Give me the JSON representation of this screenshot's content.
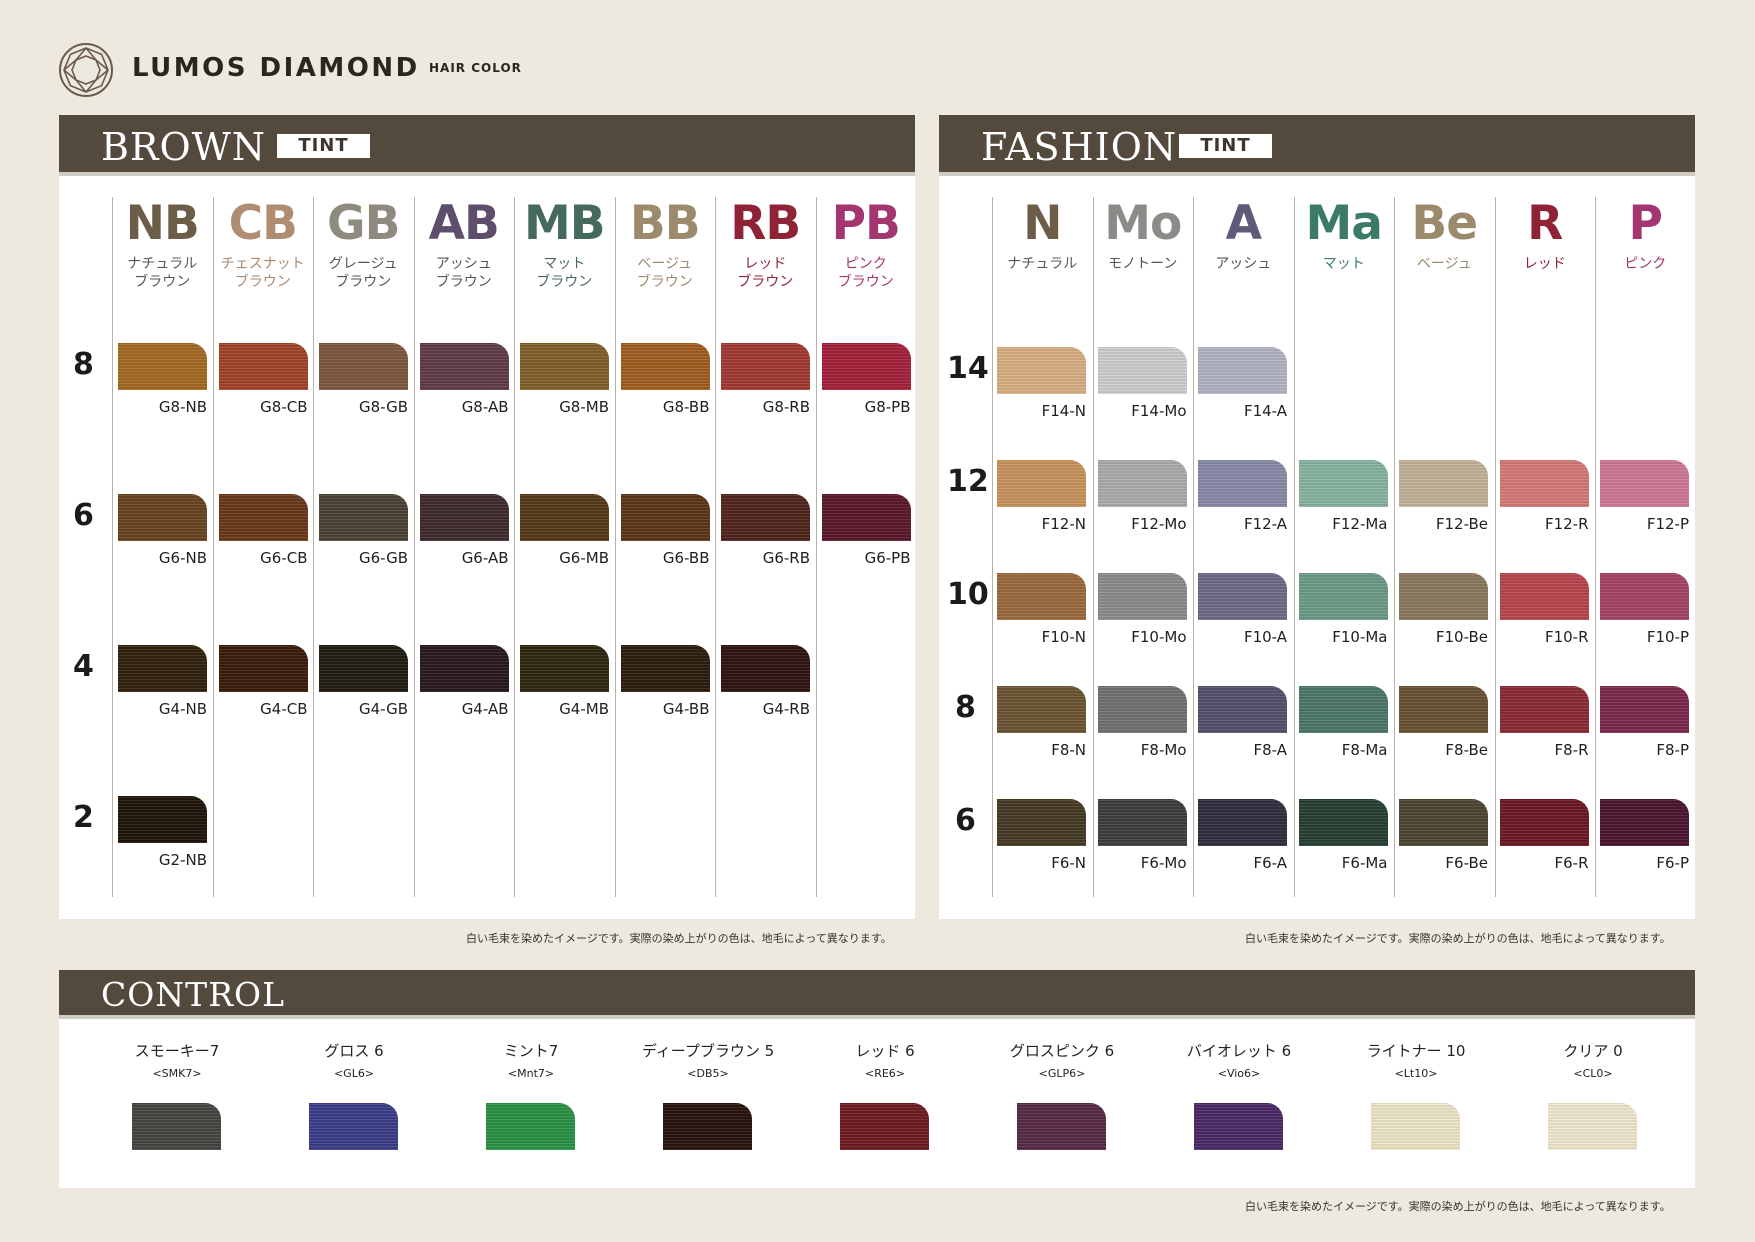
{
  "brand": {
    "name": "LUMOS DIAMOND",
    "sub": "HAIR COLOR"
  },
  "brown": {
    "title": "BROWN",
    "tag": "TINT",
    "note": "白い毛束を染めたイメージです。実際の染め上がりの色は、地毛によって異なります。",
    "levels": [
      "8",
      "6",
      "4",
      "2"
    ],
    "columns": [
      {
        "code": "NB",
        "name1": "ナチュラル",
        "name2": "ブラウン",
        "color": "#6b5d48",
        "name_color": "#555555",
        "swatches": [
          {
            "label": "G8-NB",
            "color": "#a56a24"
          },
          {
            "label": "G6-NB",
            "color": "#6a4521"
          },
          {
            "label": "G4-NB",
            "color": "#33230f"
          },
          {
            "label": "G2-NB",
            "color": "#1f160b"
          }
        ]
      },
      {
        "code": "CB",
        "name1": "チェスナット",
        "name2": "ブラウン",
        "color": "#b08c72",
        "name_color": "#a8896f",
        "swatches": [
          {
            "label": "G8-CB",
            "color": "#a2452a"
          },
          {
            "label": "G6-CB",
            "color": "#6c3a1b"
          },
          {
            "label": "G4-CB",
            "color": "#3b1e0c"
          }
        ]
      },
      {
        "code": "GB",
        "name1": "グレージュ",
        "name2": "ブラウン",
        "color": "#8f8a80",
        "name_color": "#555555",
        "swatches": [
          {
            "label": "G8-GB",
            "color": "#7d5840"
          },
          {
            "label": "G6-GB",
            "color": "#4b4438"
          },
          {
            "label": "G4-GB",
            "color": "#221c16"
          }
        ]
      },
      {
        "code": "AB",
        "name1": "アッシュ",
        "name2": "ブラウン",
        "color": "#5e4e6b",
        "name_color": "#555555",
        "swatches": [
          {
            "label": "G8-AB",
            "color": "#613d48"
          },
          {
            "label": "G6-AB",
            "color": "#3f2c2e"
          },
          {
            "label": "G4-AB",
            "color": "#2a1a1d"
          }
        ]
      },
      {
        "code": "MB",
        "name1": "マット",
        "name2": "ブラウン",
        "color": "#46695e",
        "name_color": "#46695e",
        "swatches": [
          {
            "label": "G8-MB",
            "color": "#826129"
          },
          {
            "label": "G6-MB",
            "color": "#573b1a"
          },
          {
            "label": "G4-MB",
            "color": "#2f270f"
          }
        ]
      },
      {
        "code": "BB",
        "name1": "ベージュ",
        "name2": "ブラウン",
        "color": "#9c8a6c",
        "name_color": "#9c8a6c",
        "swatches": [
          {
            "label": "G8-BB",
            "color": "#a15f21"
          },
          {
            "label": "G6-BB",
            "color": "#5d3617"
          },
          {
            "label": "G4-BB",
            "color": "#2d1f11"
          }
        ]
      },
      {
        "code": "RB",
        "name1": "レッド",
        "name2": "ブラウン",
        "color": "#8e2336",
        "name_color": "#8e2336",
        "swatches": [
          {
            "label": "G8-RB",
            "color": "#a43a34"
          },
          {
            "label": "G6-RB",
            "color": "#52251f"
          },
          {
            "label": "G4-RB",
            "color": "#2e1513"
          }
        ]
      },
      {
        "code": "PB",
        "name1": "ピンク",
        "name2": "ブラウン",
        "color": "#a3356f",
        "name_color": "#a3356f",
        "swatches": [
          {
            "label": "G8-PB",
            "color": "#a5223b"
          },
          {
            "label": "G6-PB",
            "color": "#5b1a2b"
          }
        ]
      }
    ]
  },
  "fashion": {
    "title": "FASHION",
    "tag": "TINT",
    "note": "白い毛束を染めたイメージです。実際の染め上がりの色は、地毛によって異なります。",
    "levels": [
      "14",
      "12",
      "10",
      "8",
      "6"
    ],
    "columns": [
      {
        "code": "N",
        "name": "ナチュラル",
        "color": "#6b5d48",
        "name_color": "#555555",
        "swatches": [
          {
            "level": "14",
            "label": "F14-N",
            "color": "#d9b083"
          },
          {
            "level": "12",
            "label": "F12-N",
            "color": "#c8945e"
          },
          {
            "level": "10",
            "label": "F10-N",
            "color": "#9d6b3e"
          },
          {
            "level": "8",
            "label": "F8-N",
            "color": "#6d5635"
          },
          {
            "level": "6",
            "label": "F6-N",
            "color": "#473b25"
          }
        ]
      },
      {
        "code": "Mo",
        "name": "モノトーン",
        "color": "#8d8b87",
        "name_color": "#555555",
        "swatches": [
          {
            "level": "14",
            "label": "F14-Mo",
            "color": "#cfcfd1"
          },
          {
            "level": "12",
            "label": "F12-Mo",
            "color": "#acacae"
          },
          {
            "level": "10",
            "label": "F10-Mo",
            "color": "#8d8d8f"
          },
          {
            "level": "8",
            "label": "F8-Mo",
            "color": "#727272"
          },
          {
            "level": "6",
            "label": "F6-Mo",
            "color": "#3f3f3f"
          }
        ]
      },
      {
        "code": "A",
        "name": "アッシュ",
        "color": "#5e5a7a",
        "name_color": "#555555",
        "swatches": [
          {
            "level": "14",
            "label": "F14-A",
            "color": "#b3b5c6"
          },
          {
            "level": "12",
            "label": "F12-A",
            "color": "#8a8ba8"
          },
          {
            "level": "10",
            "label": "F10-A",
            "color": "#706c8a"
          },
          {
            "level": "8",
            "label": "F8-A",
            "color": "#55526d"
          },
          {
            "level": "6",
            "label": "F6-A",
            "color": "#2f2f3e"
          }
        ]
      },
      {
        "code": "Ma",
        "name": "マット",
        "color": "#3c7a68",
        "name_color": "#3c7a68",
        "swatches": [
          {
            "level": "12",
            "label": "F12-Ma",
            "color": "#87b5a0"
          },
          {
            "level": "10",
            "label": "F10-Ma",
            "color": "#6d9c88"
          },
          {
            "level": "8",
            "label": "F8-Ma",
            "color": "#4d7868"
          },
          {
            "level": "6",
            "label": "F6-Ma",
            "color": "#284034"
          }
        ]
      },
      {
        "code": "Be",
        "name": "ベージュ",
        "color": "#9c8a6c",
        "name_color": "#9c8a6c",
        "swatches": [
          {
            "level": "12",
            "label": "F12-Be",
            "color": "#c4b59a"
          },
          {
            "level": "10",
            "label": "F10-Be",
            "color": "#8c7a5f"
          },
          {
            "level": "8",
            "label": "F8-Be",
            "color": "#6c5435"
          },
          {
            "level": "6",
            "label": "F6-Be",
            "color": "#4d4634"
          }
        ]
      },
      {
        "code": "R",
        "name": "レッド",
        "color": "#8e2336",
        "name_color": "#8e2336",
        "swatches": [
          {
            "level": "12",
            "label": "F12-R",
            "color": "#d67a76"
          },
          {
            "level": "10",
            "label": "F10-R",
            "color": "#b9464f"
          },
          {
            "level": "8",
            "label": "F8-R",
            "color": "#8d2c36"
          },
          {
            "level": "6",
            "label": "F6-R",
            "color": "#6c1a24"
          }
        ]
      },
      {
        "code": "P",
        "name": "ピンク",
        "color": "#a3356f",
        "name_color": "#a3356f",
        "swatches": [
          {
            "level": "12",
            "label": "F12-P",
            "color": "#d07a96"
          },
          {
            "level": "10",
            "label": "F10-P",
            "color": "#a54664"
          },
          {
            "level": "8",
            "label": "F8-P",
            "color": "#7e2a4e"
          },
          {
            "level": "6",
            "label": "F6-P",
            "color": "#4b1730"
          }
        ]
      }
    ]
  },
  "control": {
    "title": "CONTROL",
    "note": "白い毛束を染めたイメージです。実際の染め上がりの色は、地毛によって異なります。",
    "items": [
      {
        "name": "スモーキー7",
        "code": "<SMK7>",
        "color": "#464643"
      },
      {
        "name": "グロス 6",
        "code": "<GL6>",
        "color": "#3c3f8a"
      },
      {
        "name": "ミント7",
        "code": "<Mnt7>",
        "color": "#2c9347"
      },
      {
        "name": "ディープブラウン 5",
        "code": "<DB5>",
        "color": "#2a140e"
      },
      {
        "name": "レッド 6",
        "code": "<RE6>",
        "color": "#6f1d22"
      },
      {
        "name": "グロスピンク 6",
        "code": "<GLP6>",
        "color": "#582b48"
      },
      {
        "name": "バイオレット 6",
        "code": "<Vio6>",
        "color": "#4c2a66"
      },
      {
        "name": "ライトナー 10",
        "code": "<Lt10>",
        "color": "#efe6c8"
      },
      {
        "name": "クリア 0",
        "code": "<CL0>",
        "color": "#efe8cf"
      }
    ]
  }
}
